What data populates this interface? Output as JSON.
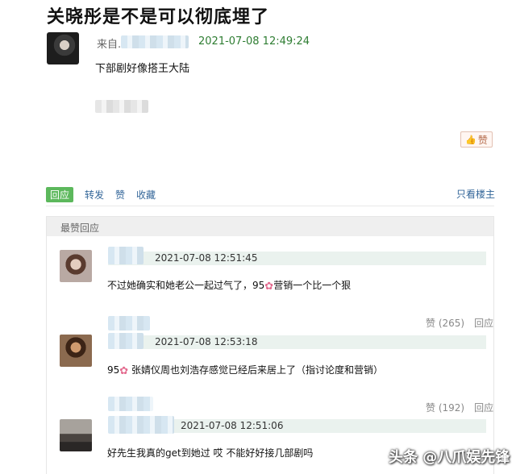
{
  "post": {
    "title": "关晓彤是不是可以彻底埋了",
    "from_label": "来自",
    "time": "2021-07-08 12:49:24",
    "body": "下部剧好像搭王大陆",
    "like_label": "赞"
  },
  "actions": {
    "reply": "回应",
    "repost": "转发",
    "like": "赞",
    "collect": "收藏",
    "only_op": "只看楼主"
  },
  "top_replies": {
    "header": "最赞回应",
    "items": [
      {
        "time": "2021-07-08 12:51:45",
        "text_a": "不过她确实和她老公一起过气了，95",
        "text_b": "营销一个比一个狠",
        "likes_label": "赞 (265)",
        "reply_label": "回应"
      },
      {
        "time": "2021-07-08 12:53:18",
        "text_a": "95",
        "text_b": "张婧仪周也刘浩存感觉已经后来居上了（指讨论度和营销）",
        "likes_label": "赞 (192)",
        "reply_label": "回应"
      },
      {
        "time": "2021-07-08 12:51:06",
        "text_a": "好先生我真的get到她过 哎 不能好好接几部剧吗",
        "text_b": ""
      }
    ]
  },
  "watermark": "头条 @八爪娱先锋",
  "colors": {
    "accent_green": "#5cb85c",
    "link_blue": "#336699",
    "time_green": "#2e7d32"
  },
  "icons": {
    "like": "thumbs-up-icon",
    "flower": "flower-icon"
  }
}
